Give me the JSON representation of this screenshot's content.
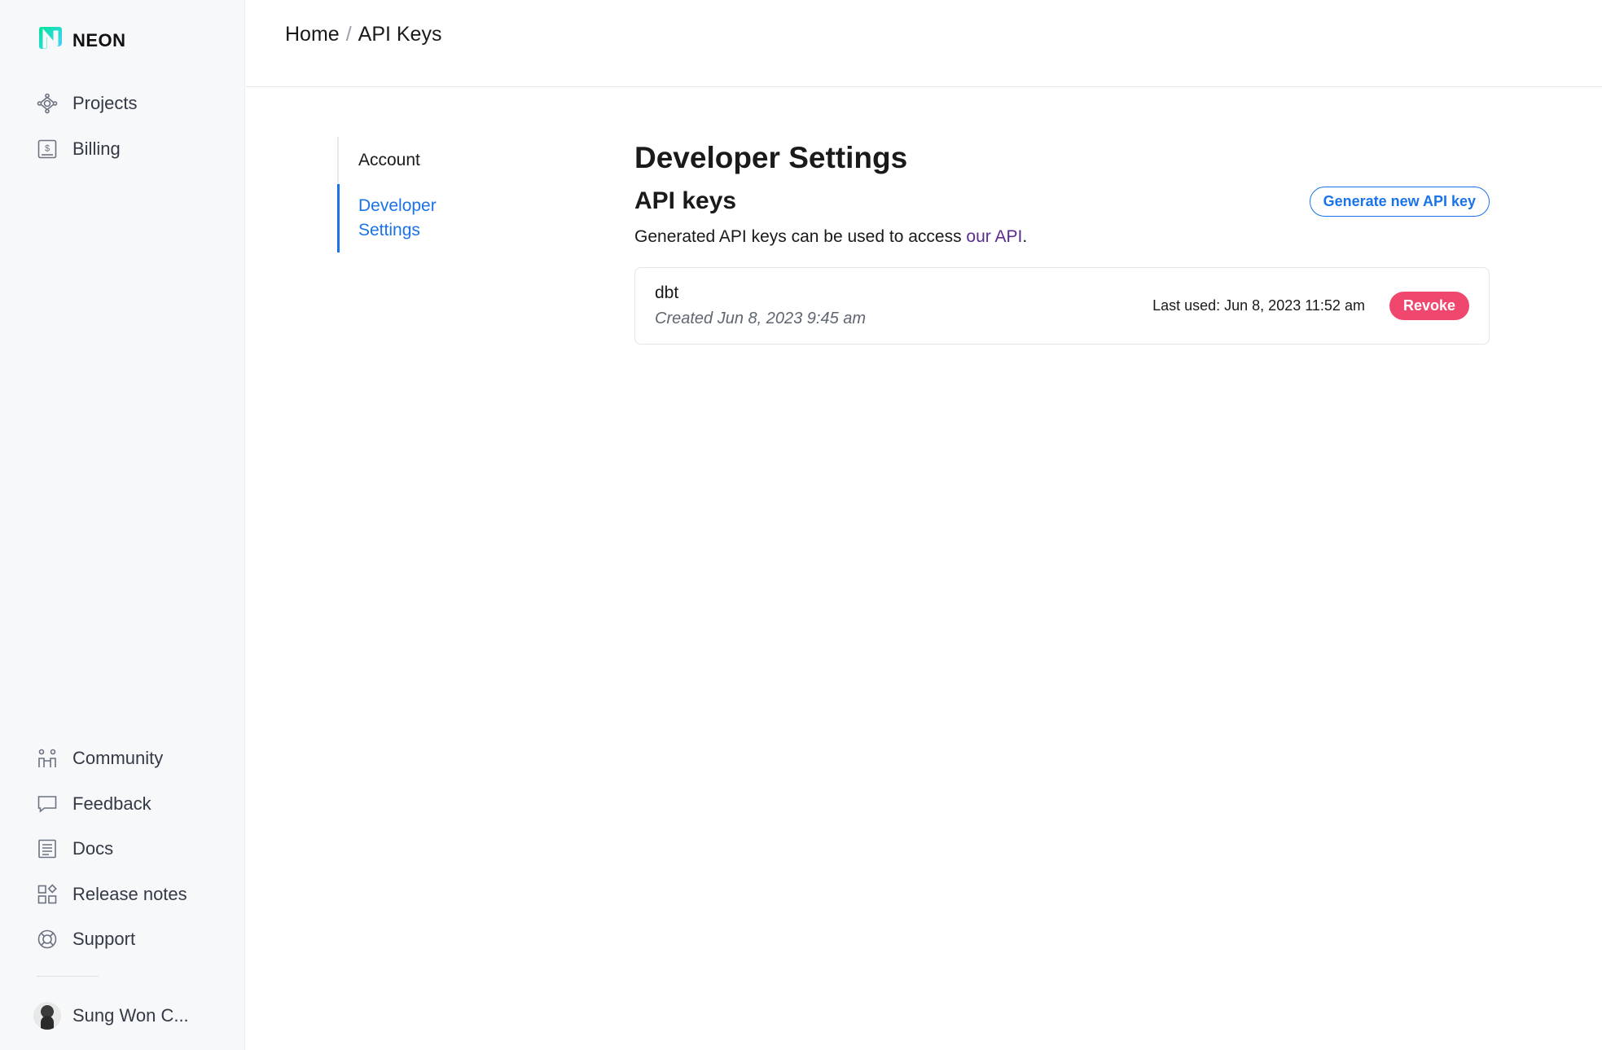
{
  "app": {
    "logo_text": "NEON"
  },
  "sidebar": {
    "top_items": [
      {
        "label": "Projects",
        "icon": "projects-icon"
      },
      {
        "label": "Billing",
        "icon": "billing-icon"
      }
    ],
    "bottom_items": [
      {
        "label": "Community",
        "icon": "community-icon"
      },
      {
        "label": "Feedback",
        "icon": "feedback-icon"
      },
      {
        "label": "Docs",
        "icon": "docs-icon"
      },
      {
        "label": "Release notes",
        "icon": "release-notes-icon"
      },
      {
        "label": "Support",
        "icon": "support-icon"
      }
    ],
    "user": {
      "name": "Sung Won C..."
    }
  },
  "breadcrumb": {
    "home": "Home",
    "separator": "/",
    "current": "API Keys"
  },
  "subnav": {
    "items": [
      {
        "label": "Account",
        "active": false
      },
      {
        "label": "Developer Settings",
        "active": true
      }
    ]
  },
  "main": {
    "title": "Developer Settings",
    "section_title": "API keys",
    "generate_button": "Generate new API key",
    "description_prefix": "Generated API keys can be used to access ",
    "description_link": "our API",
    "description_suffix": ".",
    "keys": [
      {
        "name": "dbt",
        "created": "Created Jun 8, 2023 9:45 am",
        "last_used": "Last used: Jun 8, 2023 11:52 am",
        "action": "Revoke"
      }
    ]
  },
  "colors": {
    "accent": "#1a73e8",
    "danger": "#f0476f",
    "link": "#5b2c8f",
    "logo_gradient_start": "#00e599",
    "logo_gradient_end": "#4ad1ff"
  }
}
